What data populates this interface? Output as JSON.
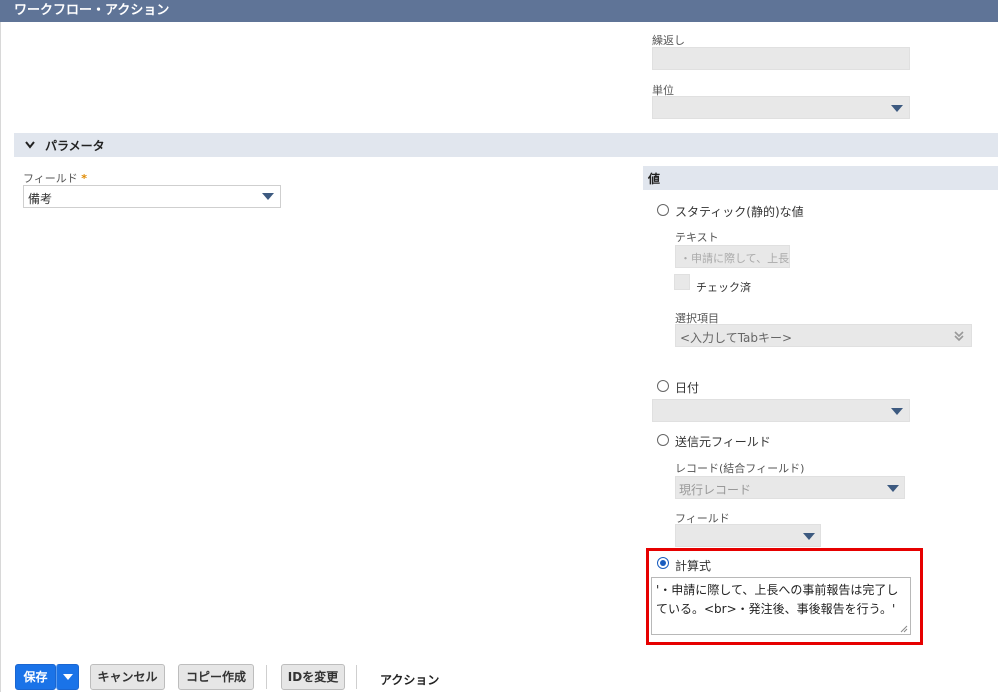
{
  "window": {
    "title": "ワークフロー・アクション"
  },
  "top": {
    "repeat_label": "繰返し",
    "repeat_value": "",
    "unit_label": "単位",
    "unit_value": ""
  },
  "params": {
    "section_label": "パラメータ",
    "field_label": "フィールド",
    "required_mark": "*",
    "field_value": "備考",
    "value_header": "値",
    "static": {
      "radio_label": "スタティック(静的)な値",
      "text_label": "テキスト",
      "text_value": "・申請に際して、上長",
      "checkbox_label": "チェック済",
      "select_label": "選択項目",
      "select_placeholder": "<入力してTabキー>"
    },
    "date": {
      "radio_label": "日付"
    },
    "sender": {
      "radio_label": "送信元フィールド",
      "record_label": "レコード(結合フィールド)",
      "record_value": "現行レコード",
      "field_label": "フィールド"
    },
    "formula": {
      "radio_label": "計算式",
      "value": "'・申請に際して、上長への事前報告は完了している。<br>・発注後、事後報告を行う。'"
    }
  },
  "footer": {
    "save_label": "保存",
    "cancel_label": "キャンセル",
    "copy_label": "コピー作成",
    "change_id_label": "IDを変更",
    "action_label": "アクション"
  },
  "colors": {
    "accent": "#1a73e8",
    "titlebar": "#5f7497",
    "highlight": "#e60000"
  }
}
